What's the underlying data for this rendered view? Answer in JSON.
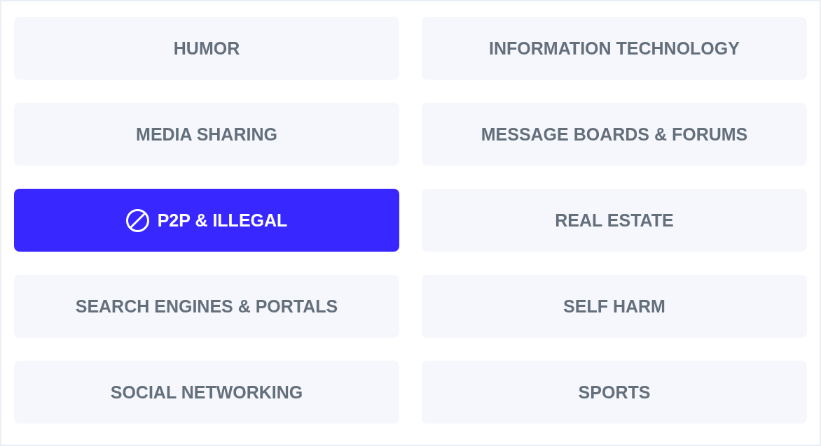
{
  "categories": [
    {
      "label": "HUMOR",
      "selected": false
    },
    {
      "label": "INFORMATION TECHNOLOGY",
      "selected": false
    },
    {
      "label": "MEDIA SHARING",
      "selected": false
    },
    {
      "label": "MESSAGE BOARDS & FORUMS",
      "selected": false
    },
    {
      "label": "P2P & ILLEGAL",
      "selected": true
    },
    {
      "label": "REAL ESTATE",
      "selected": false
    },
    {
      "label": "SEARCH ENGINES & PORTALS",
      "selected": false
    },
    {
      "label": "SELF HARM",
      "selected": false
    },
    {
      "label": "SOCIAL NETWORKING",
      "selected": false
    },
    {
      "label": "SPORTS",
      "selected": false
    }
  ]
}
